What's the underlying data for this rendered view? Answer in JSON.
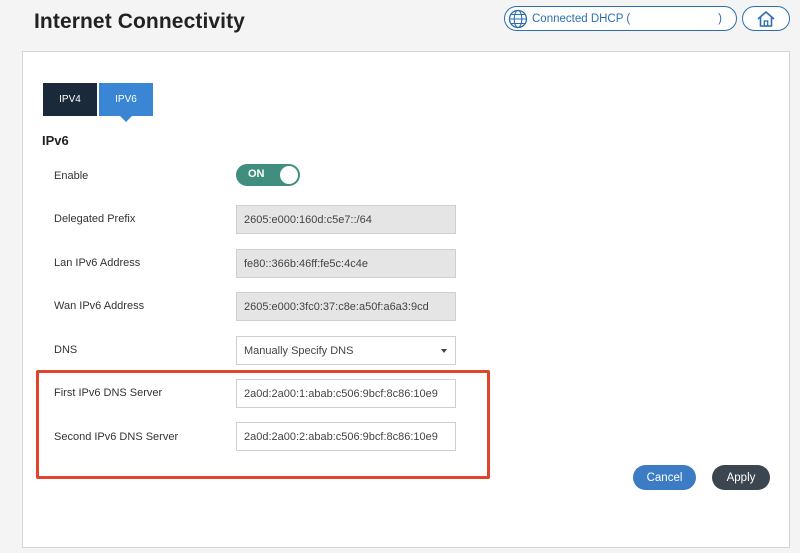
{
  "header": {
    "title": "Internet Connectivity",
    "status_text": "Connected  DHCP  (",
    "status_close": ")"
  },
  "tabs": [
    {
      "label": "IPV4",
      "active": false
    },
    {
      "label": "IPV6",
      "active": true
    }
  ],
  "section": {
    "title": "IPv6"
  },
  "rows": {
    "enable": {
      "label": "Enable",
      "toggle_text": "ON",
      "on": true
    },
    "delegated_prefix": {
      "label": "Delegated Prefix",
      "value": "2605:e000:160d:c5e7::/64"
    },
    "lan_ipv6": {
      "label": "Lan IPv6 Address",
      "value": "fe80::366b:46ff:fe5c:4c4e"
    },
    "wan_ipv6": {
      "label": "Wan IPv6 Address",
      "value": "2605:e000:3fc0:37:c8e:a50f:a6a3:9cd"
    },
    "dns": {
      "label": "DNS",
      "value": "Manually Specify DNS"
    },
    "first_dns": {
      "label": "First IPv6 DNS Server",
      "value": "2a0d:2a00:1:abab:c506:9bcf:8c86:10e9"
    },
    "second_dns": {
      "label": "Second IPv6 DNS Server",
      "value": "2a0d:2a00:2:abab:c506:9bcf:8c86:10e9"
    }
  },
  "buttons": {
    "cancel": "Cancel",
    "apply": "Apply"
  },
  "icons": {
    "status": "globe-icon",
    "home": "home-icon",
    "dropdown": "caret-down-icon"
  },
  "colors": {
    "accent": "#3b86d4",
    "tab_dark": "#1b2a3a",
    "toggle_on": "#3f8e7f",
    "highlight": "#e0452c",
    "apply": "#3c4650"
  }
}
